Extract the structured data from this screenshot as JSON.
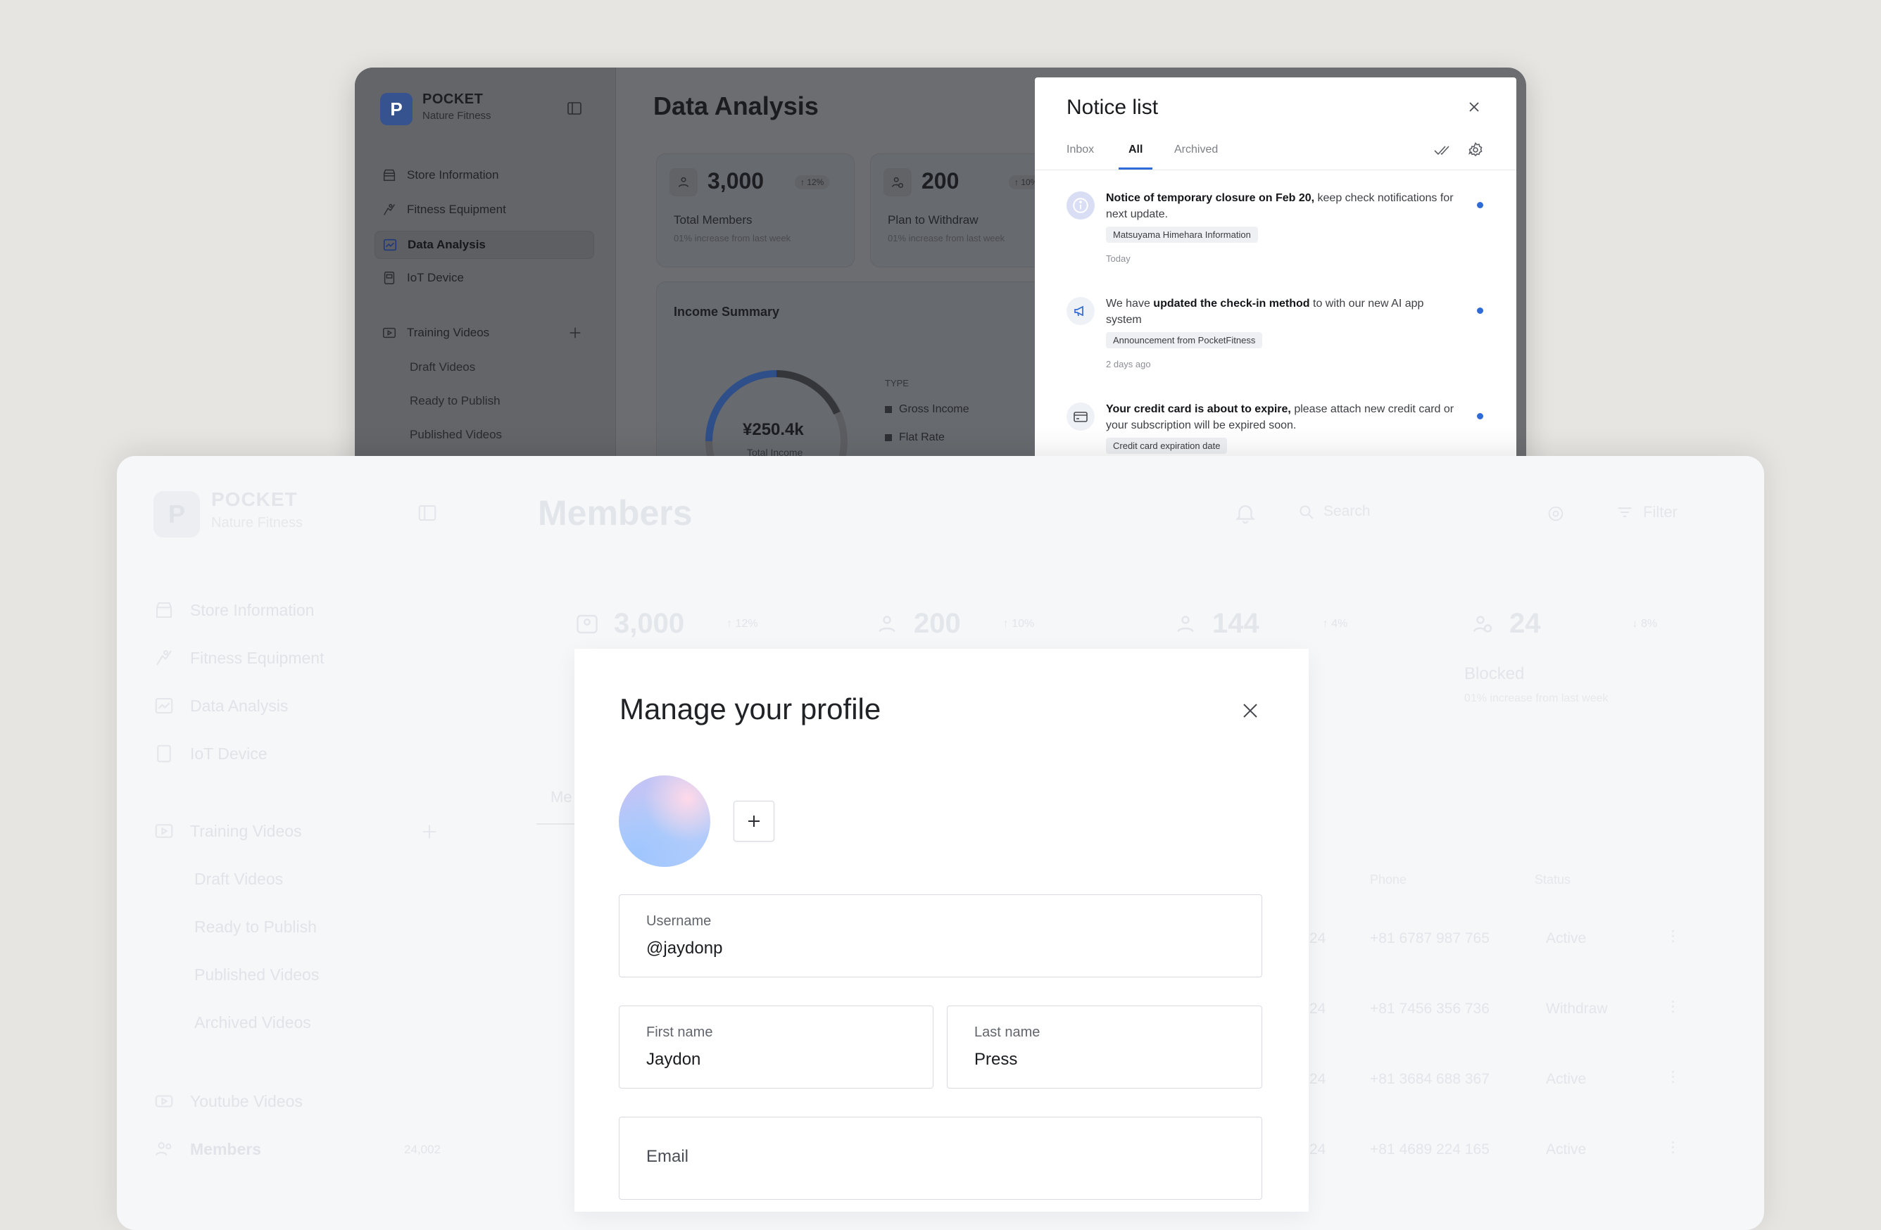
{
  "back": {
    "brand": "POCKET",
    "brand_sub": "Nature Fitness",
    "nav": [
      {
        "label": "Store Information",
        "icon": "store-icon"
      },
      {
        "label": "Fitness Equipment",
        "icon": "dumbbell-icon"
      },
      {
        "label": "Data Analysis",
        "icon": "chart-icon",
        "active": true
      },
      {
        "label": "IoT Device",
        "icon": "device-icon"
      }
    ],
    "training_label": "Training Videos",
    "training_sub": [
      "Draft Videos",
      "Ready to Publish",
      "Published Videos"
    ],
    "page_title": "Data Analysis",
    "stats": [
      {
        "value": "3,000",
        "change": "↑ 12%",
        "label": "Total Members",
        "hint": "01% increase from last week"
      },
      {
        "value": "200",
        "change": "↑ 10%",
        "label": "Plan to Withdraw",
        "hint": "01% increase from last week"
      }
    ],
    "income": {
      "title": "Income Summary",
      "amount": "¥250.4k",
      "amount_label": "Total Income",
      "type_header": "TYPE",
      "types": [
        "Gross Income",
        "Flat Rate"
      ]
    }
  },
  "notice": {
    "title": "Notice list",
    "tabs": [
      "Inbox",
      "All",
      "Archived"
    ],
    "active_tab": "All",
    "items": [
      {
        "b1": "Notice of temporary closure on Feb 20,",
        "t1": " keep check notifications for next update.",
        "tag": "Matsuyama Himehara Information",
        "time": "Today",
        "icon": "info-icon"
      },
      {
        "t0": "We have ",
        "b1": "updated the check-in method",
        "t1": " to with our new AI app system",
        "tag": "Announcement from PocketFitness",
        "time": "2 days ago",
        "icon": "megaphone-icon"
      },
      {
        "b1": "Your credit card is about to expire,",
        "t1": " please attach new credit card or your subscription will be expired soon.",
        "tag": "Credit card expiration date",
        "time": "",
        "icon": "credit-card-icon"
      }
    ]
  },
  "front": {
    "brand": "POCKET",
    "brand_sub": "Nature Fitness",
    "page_title": "Members",
    "search_placeholder": "Search",
    "filter_label": "Filter",
    "nav": [
      "Store Information",
      "Fitness Equipment",
      "Data Analysis",
      "IoT Device"
    ],
    "training_label": "Training Videos",
    "training_sub": [
      "Draft Videos",
      "Ready to Publish",
      "Published Videos",
      "Archived Videos"
    ],
    "youtube_label": "Youtube Videos",
    "members_label": "Members",
    "members_count": "24,002",
    "stats": [
      {
        "value": "3,000",
        "change": "↑ 12%"
      },
      {
        "value": "200",
        "change": "↑ 10%"
      },
      {
        "value": "144",
        "change": "↑ 4%"
      },
      {
        "value": "24",
        "change": "↓ 8%",
        "label": "Blocked",
        "hint": "01% increase from last week"
      }
    ],
    "table_headers": [
      "Phone",
      "Status"
    ],
    "rows": [
      {
        "date": "24",
        "phone": "+81 6787 987 765",
        "status": "Active"
      },
      {
        "date": "24",
        "phone": "+81 7456 356 736",
        "status": "Withdraw"
      },
      {
        "date": "24",
        "phone": "+81 3684 688 367",
        "status": "Active"
      },
      {
        "date": "24",
        "phone": "+81 4689 224 165",
        "status": "Active"
      }
    ],
    "tab_stub": "Me"
  },
  "profile": {
    "title": "Manage your profile",
    "username_label": "Username",
    "username": "@jaydonp",
    "first_name_label": "First name",
    "first_name": "Jaydon",
    "last_name_label": "Last name",
    "last_name": "Press",
    "email_label": "Email"
  }
}
